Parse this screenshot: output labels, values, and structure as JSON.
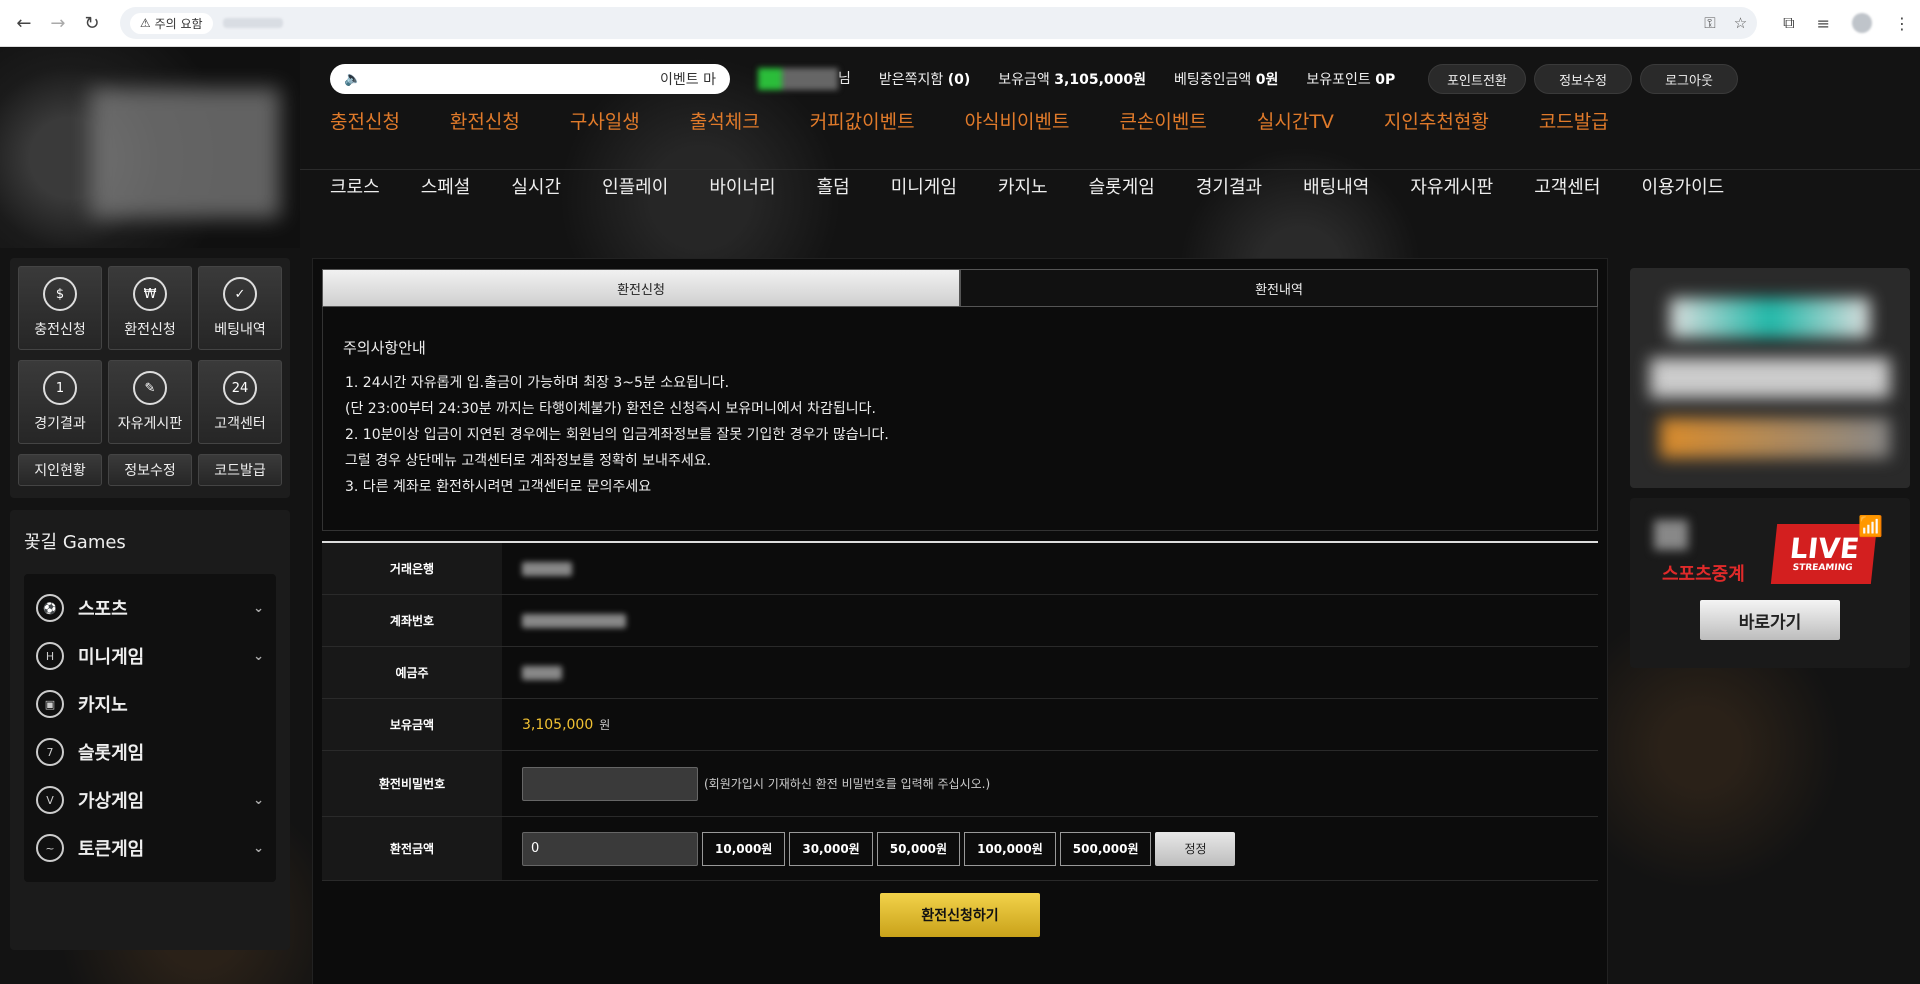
{
  "browser": {
    "security_label": "주의 요함"
  },
  "ticker": {
    "text": "이벤트 마"
  },
  "userinfo": {
    "suffix": "님",
    "messages_label": "받은쪽지함",
    "messages_count": "(0)",
    "balance_label": "보유금액",
    "balance_value": "3,105,000원",
    "betting_label": "베팅중인금액",
    "betting_value": "0원",
    "points_label": "보유포인트",
    "points_value": "0P"
  },
  "top_buttons": [
    "포인트전환",
    "정보수정",
    "로그아웃"
  ],
  "menu_primary": [
    "충전신청",
    "환전신청",
    "구사일생",
    "출석체크",
    "커피값이벤트",
    "야식비이벤트",
    "큰손이벤트",
    "실시간TV",
    "지인추천현황",
    "코드발급"
  ],
  "menu_secondary": [
    "크로스",
    "스페셜",
    "실시간",
    "인플레이",
    "바이너리",
    "홀덤",
    "미니게임",
    "카지노",
    "슬롯게임",
    "경기결과",
    "배팅내역",
    "자유게시판",
    "고객센터",
    "이용가이드"
  ],
  "shortcuts": [
    {
      "label": "충전신청",
      "icon": "$"
    },
    {
      "label": "환전신청",
      "icon": "₩"
    },
    {
      "label": "베팅내역",
      "icon": "✓"
    },
    {
      "label": "경기결과",
      "icon": "1"
    },
    {
      "label": "자유게시판",
      "icon": "✎"
    },
    {
      "label": "고객센터",
      "icon": "24"
    }
  ],
  "shortcuts_small": [
    "지인현황",
    "정보수정",
    "코드발급"
  ],
  "games": {
    "title": "꽃길 Games",
    "items": [
      {
        "label": "스포츠",
        "icon": "⚽",
        "expand": "⌄"
      },
      {
        "label": "미니게임",
        "icon": "H",
        "expand": "⌄"
      },
      {
        "label": "카지노",
        "icon": "▣",
        "expand": ""
      },
      {
        "label": "슬롯게임",
        "icon": "7",
        "expand": ""
      },
      {
        "label": "가상게임",
        "icon": "V",
        "expand": "⌄"
      },
      {
        "label": "토큰게임",
        "icon": "~",
        "expand": "⌄"
      }
    ]
  },
  "tabs": {
    "active": "환전신청",
    "inactive": "환전내역"
  },
  "notice": {
    "title": "주의사항안내",
    "lines": [
      "1. 24시간 자유롭게 입.출금이 가능하며 최장 3~5분 소요됩니다.",
      " (단 23:00부터 24:30분 까지는 타행이체불가) 환전은 신청즉시 보유머니에서 차감됩니다.",
      "2. 10분이상 입금이 지연된 경우에는 회원님의 입금계좌정보를 잘못 기입한 경우가 많습니다.",
      "  그럴 경우 상단메뉴 고객센터로 계좌정보를 정확히 보내주세요.",
      "3. 다른 계좌로 환전하시려면 고객센터로 문의주세요"
    ]
  },
  "form": {
    "bank_label": "거래은행",
    "account_label": "계좌번호",
    "holder_label": "예금주",
    "balance_label": "보유금액",
    "balance_value": "3,105,000",
    "balance_unit": "원",
    "password_label": "환전비밀번호",
    "password_hint": "(회원가입시 기재하신 환전 비밀번호를 입력해 주십시오.)",
    "amount_label": "환전금액",
    "amount_value": "0",
    "amount_buttons": [
      "10,000원",
      "30,000원",
      "50,000원",
      "100,000원",
      "500,000원"
    ],
    "reset_label": "정정",
    "submit_label": "환전신청하기"
  },
  "live_banner": {
    "sports_label": "스포츠중계",
    "live_label": "LIVE",
    "streaming_label": "STREAMING",
    "go_label": "바로가기"
  }
}
